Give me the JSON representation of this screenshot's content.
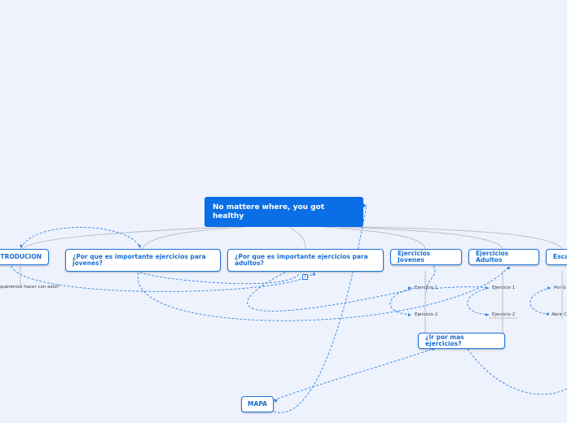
{
  "map": {
    "central_topic": "No mattere where, you got healthy",
    "topics": {
      "introduccion": "INTRODUCION",
      "jovenes": "¿Por que es importante ejercicios para jovenes?",
      "adultos": "¿Por que es importante ejercicios para adultos?",
      "ej_jovenes": "Ejercicios Jovenes",
      "ej_adultos": "Ejercicios Adultos",
      "escalera": "Esca",
      "mas_ejercicios": "¿Ir por mas ejercicios?",
      "mapa": "MAPA"
    },
    "subtopics": {
      "intro_leaf": "queremos hacer con esto?",
      "jov_ej1": "Ejercicio 1",
      "jov_ej2": "Ejercicio 2",
      "adu_ej1": "Ejercicio 1",
      "adu_ej2": "Ejercicio 2",
      "esc_1": "Por G",
      "esc_2": "Abrir C"
    },
    "collapse_badge": "1"
  },
  "colors": {
    "background": "#eef2fd",
    "central": "#0a6fe6",
    "border": "#1f74d9",
    "link": "#2f86df",
    "branch": "#b9bfca"
  }
}
